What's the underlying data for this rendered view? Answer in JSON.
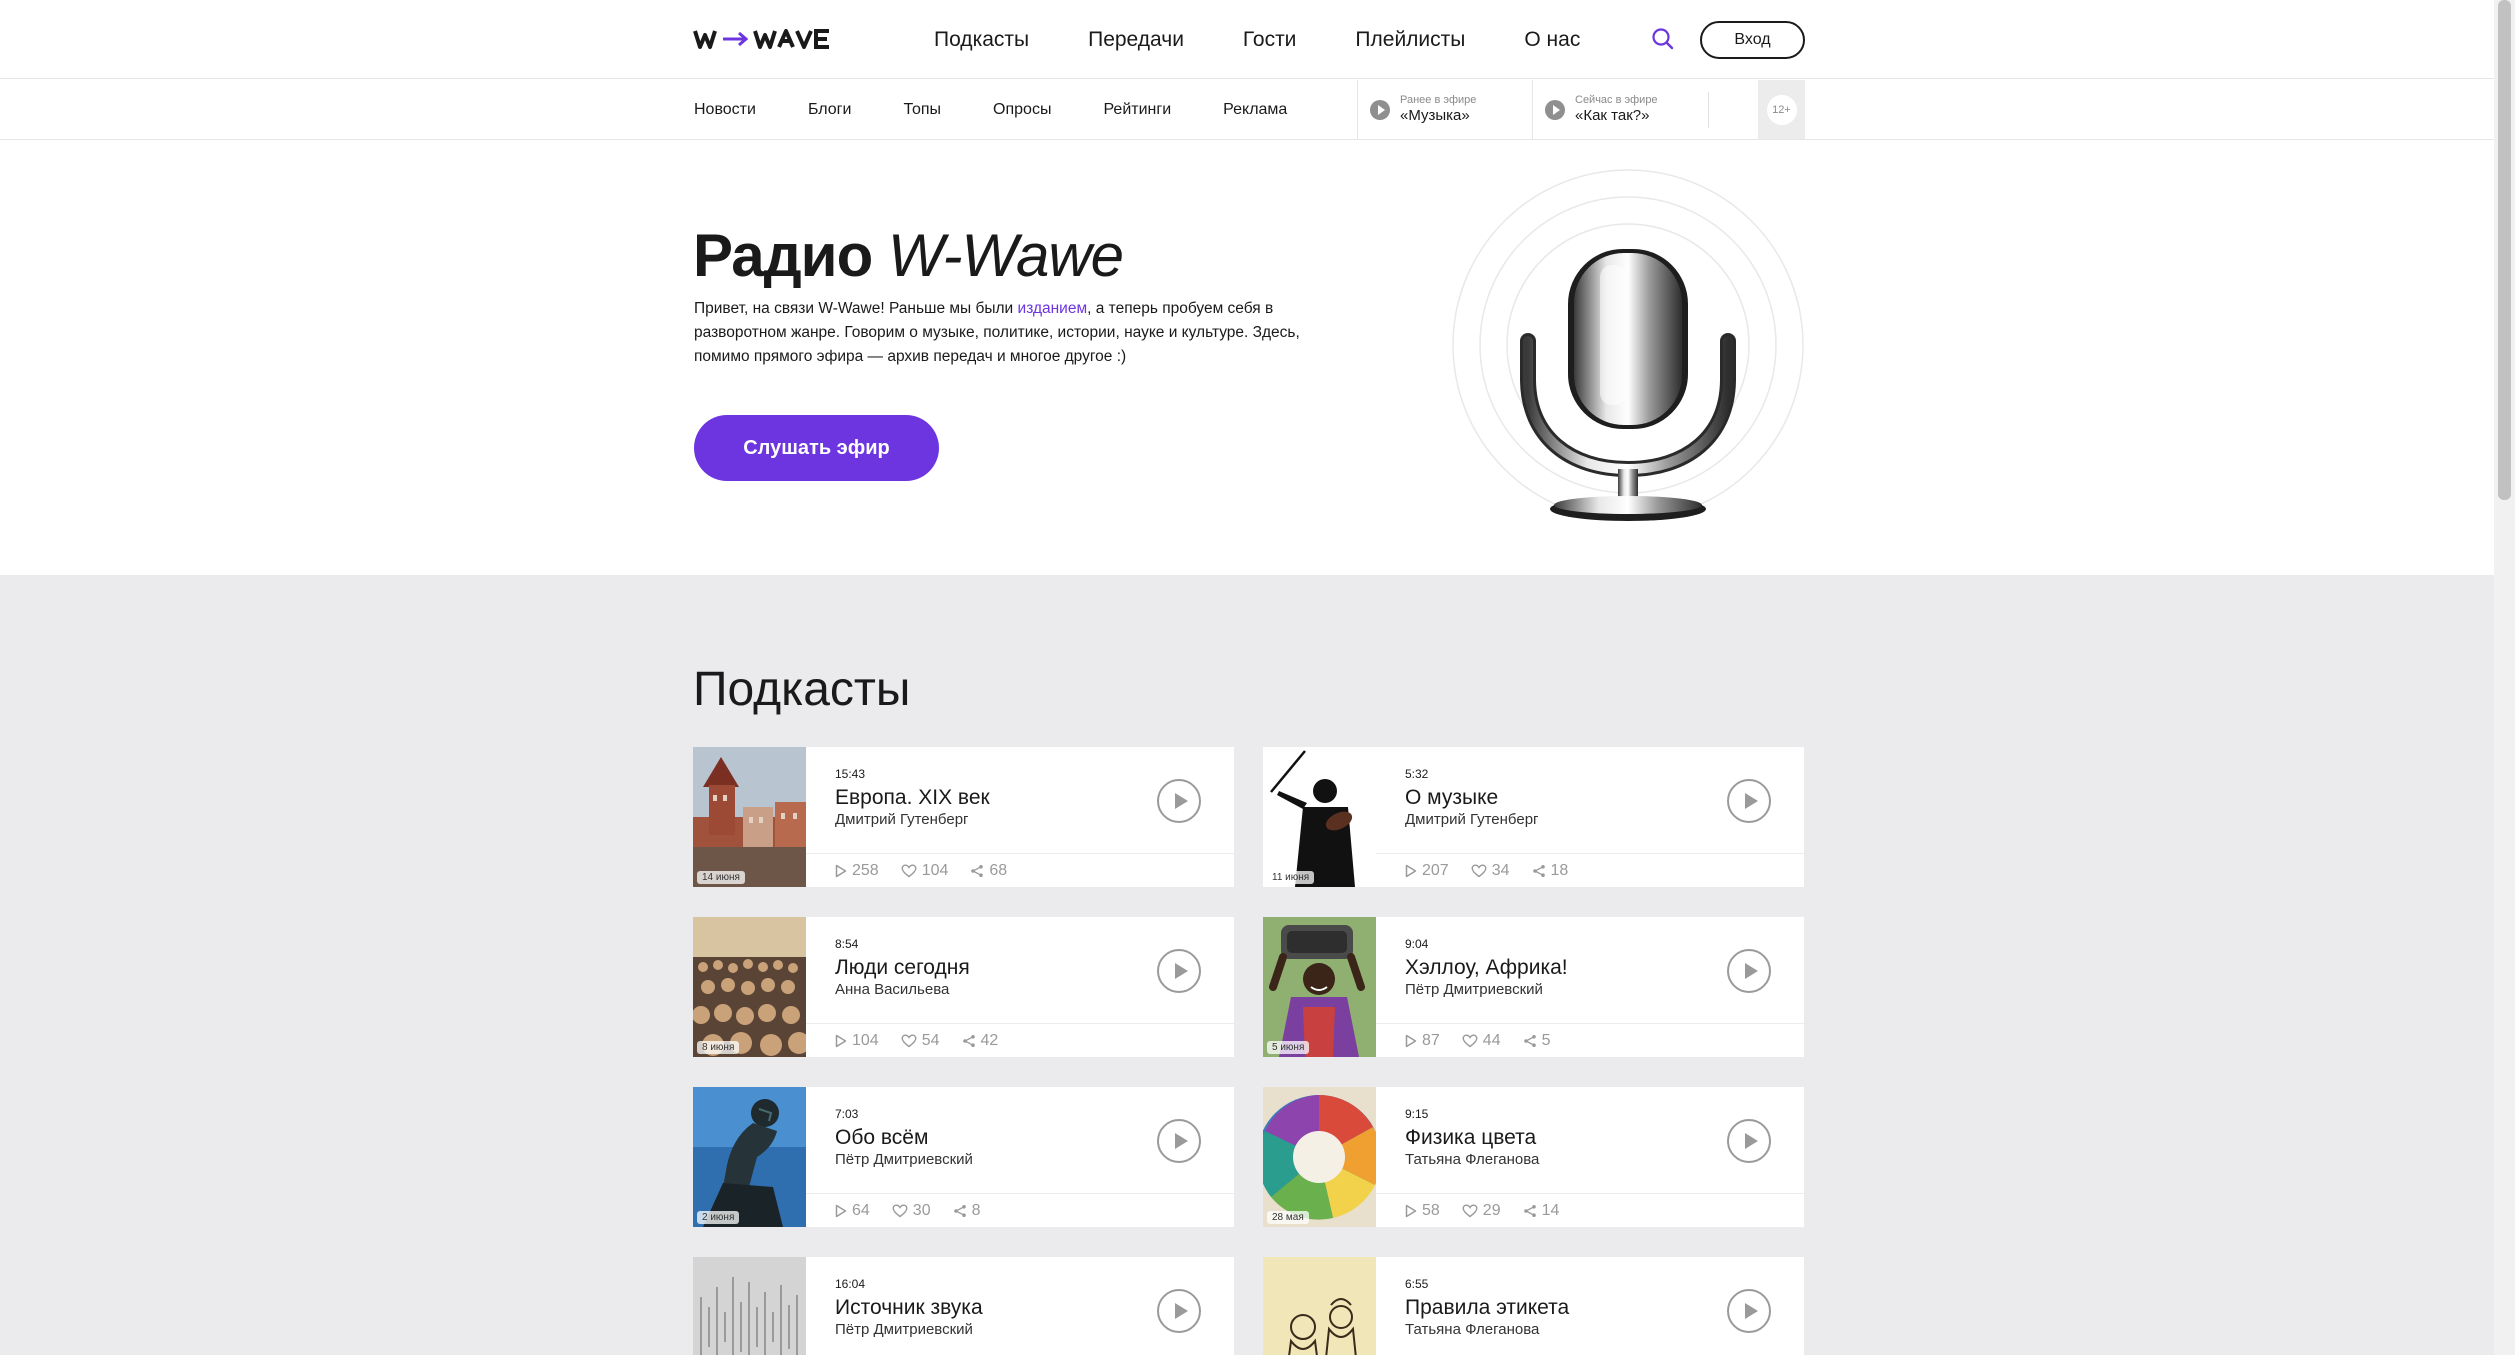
{
  "header": {
    "nav": [
      "Подкасты",
      "Передачи",
      "Гости",
      "Плейлисты",
      "О нас"
    ],
    "login_label": "Вход"
  },
  "subnav": {
    "items": [
      "Новости",
      "Блоги",
      "Топы",
      "Опросы",
      "Рейтинги",
      "Реклама"
    ],
    "previous": {
      "caption": "Ранее в эфире",
      "title": "«Музыка»"
    },
    "current": {
      "caption": "Сейчас в эфире",
      "title": "«Как так?»"
    },
    "age_rating": "12+"
  },
  "hero": {
    "title_bold": "Радио",
    "title_italic": "W-Wawe",
    "desc_before": "Привет, на связи W-Wawe! Раньше мы были ",
    "desc_link": "изданием",
    "desc_after": ", а теперь пробуем себя в разворотном жанре. Говорим о музыке, политике, истории, науке и культуре. Здесь, помимо прямого эфира — архив передач и многое другое :)",
    "button_label": "Слушать эфир"
  },
  "section_title": "Подкасты",
  "accent_color": "#6c35e0",
  "podcasts": [
    {
      "duration": "15:43",
      "title": "Европа. XIX век",
      "author": "Дмитрий Гутенберг",
      "date": "14 июня",
      "plays": "258",
      "likes": "104",
      "shares": "68",
      "image": "european-town"
    },
    {
      "duration": "5:32",
      "title": "О музыке",
      "author": "Дмитрий Гутенберг",
      "date": "11 июня",
      "plays": "207",
      "likes": "34",
      "shares": "18",
      "image": "violinist"
    },
    {
      "duration": "8:54",
      "title": "Люди сегодня",
      "author": "Анна Васильева",
      "date": "8 июня",
      "plays": "104",
      "likes": "54",
      "shares": "42",
      "image": "crowd"
    },
    {
      "duration": "9:04",
      "title": "Хэллоу, Африка!",
      "author": "Пётр Дмитриевский",
      "date": "5 июня",
      "plays": "87",
      "likes": "44",
      "shares": "5",
      "image": "african-man"
    },
    {
      "duration": "7:03",
      "title": "Обо всём",
      "author": "Пётр Дмитриевский",
      "date": "2 июня",
      "plays": "64",
      "likes": "30",
      "shares": "8",
      "image": "thinker-statue"
    },
    {
      "duration": "9:15",
      "title": "Физика цвета",
      "author": "Татьяна Флеганова",
      "date": "28 мая",
      "plays": "58",
      "likes": "29",
      "shares": "14",
      "image": "color-wheel"
    },
    {
      "duration": "16:04",
      "title": "Источник звука",
      "author": "Пётр Дмитриевский",
      "image": "sound-waves"
    },
    {
      "duration": "6:55",
      "title": "Правила этикета",
      "author": "Татьяна Флеганова",
      "image": "vintage-engraving"
    }
  ]
}
